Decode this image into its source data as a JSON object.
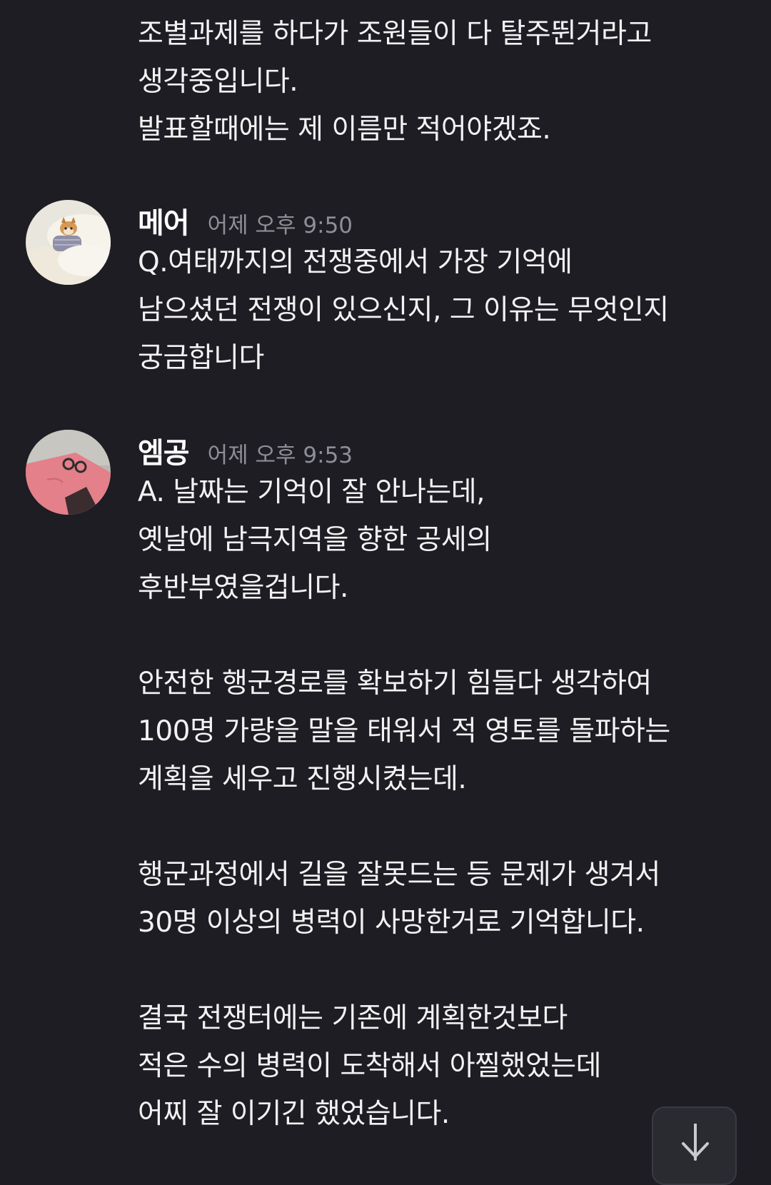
{
  "messages": [
    {
      "continuation": true,
      "lines": [
        "조별과제를 하다가 조원들이 다 탈주뛴거라고",
        "생각중입니다.",
        "발표할때에는 제 이름만 적어야겠죠."
      ]
    },
    {
      "author": "메어",
      "time": "어제 오후 9:50",
      "avatar_icon": "dog-under-blanket-avatar",
      "lines": [
        "Q.여태까지의 전쟁중에서 가장 기억에",
        "남으셨던 전쟁이 있으신지, 그 이유는 무엇인지",
        "궁금합니다"
      ]
    },
    {
      "author": "엠공",
      "time": "어제 오후 9:53",
      "avatar_icon": "pink-sunglasses-avatar",
      "lines": [
        "A. 날짜는 기억이 잘 안나는데,",
        "옛날에 남극지역을 향한 공세의",
        "후반부였을겁니다.",
        "",
        "안전한 행군경로를 확보하기 힘들다 생각하여",
        "100명 가량을 말을 태워서 적 영토를 돌파하는",
        "계획을 세우고 진행시켰는데.",
        "",
        "행군과정에서 길을 잘못드는 등 문제가 생겨서",
        "30명 이상의 병력이 사망한거로 기억합니다.",
        "",
        "결국 전쟁터에는 기존에 계획한것보다",
        "적은 수의 병력이 도착해서 아찔했었는데",
        "어찌 잘 이기긴 했었습니다."
      ]
    }
  ],
  "scroll_button": {
    "icon": "arrow-down-icon"
  },
  "colors": {
    "background": "#1d1d23",
    "text": "#f2f2f3",
    "timestamp": "#8e8e96"
  }
}
